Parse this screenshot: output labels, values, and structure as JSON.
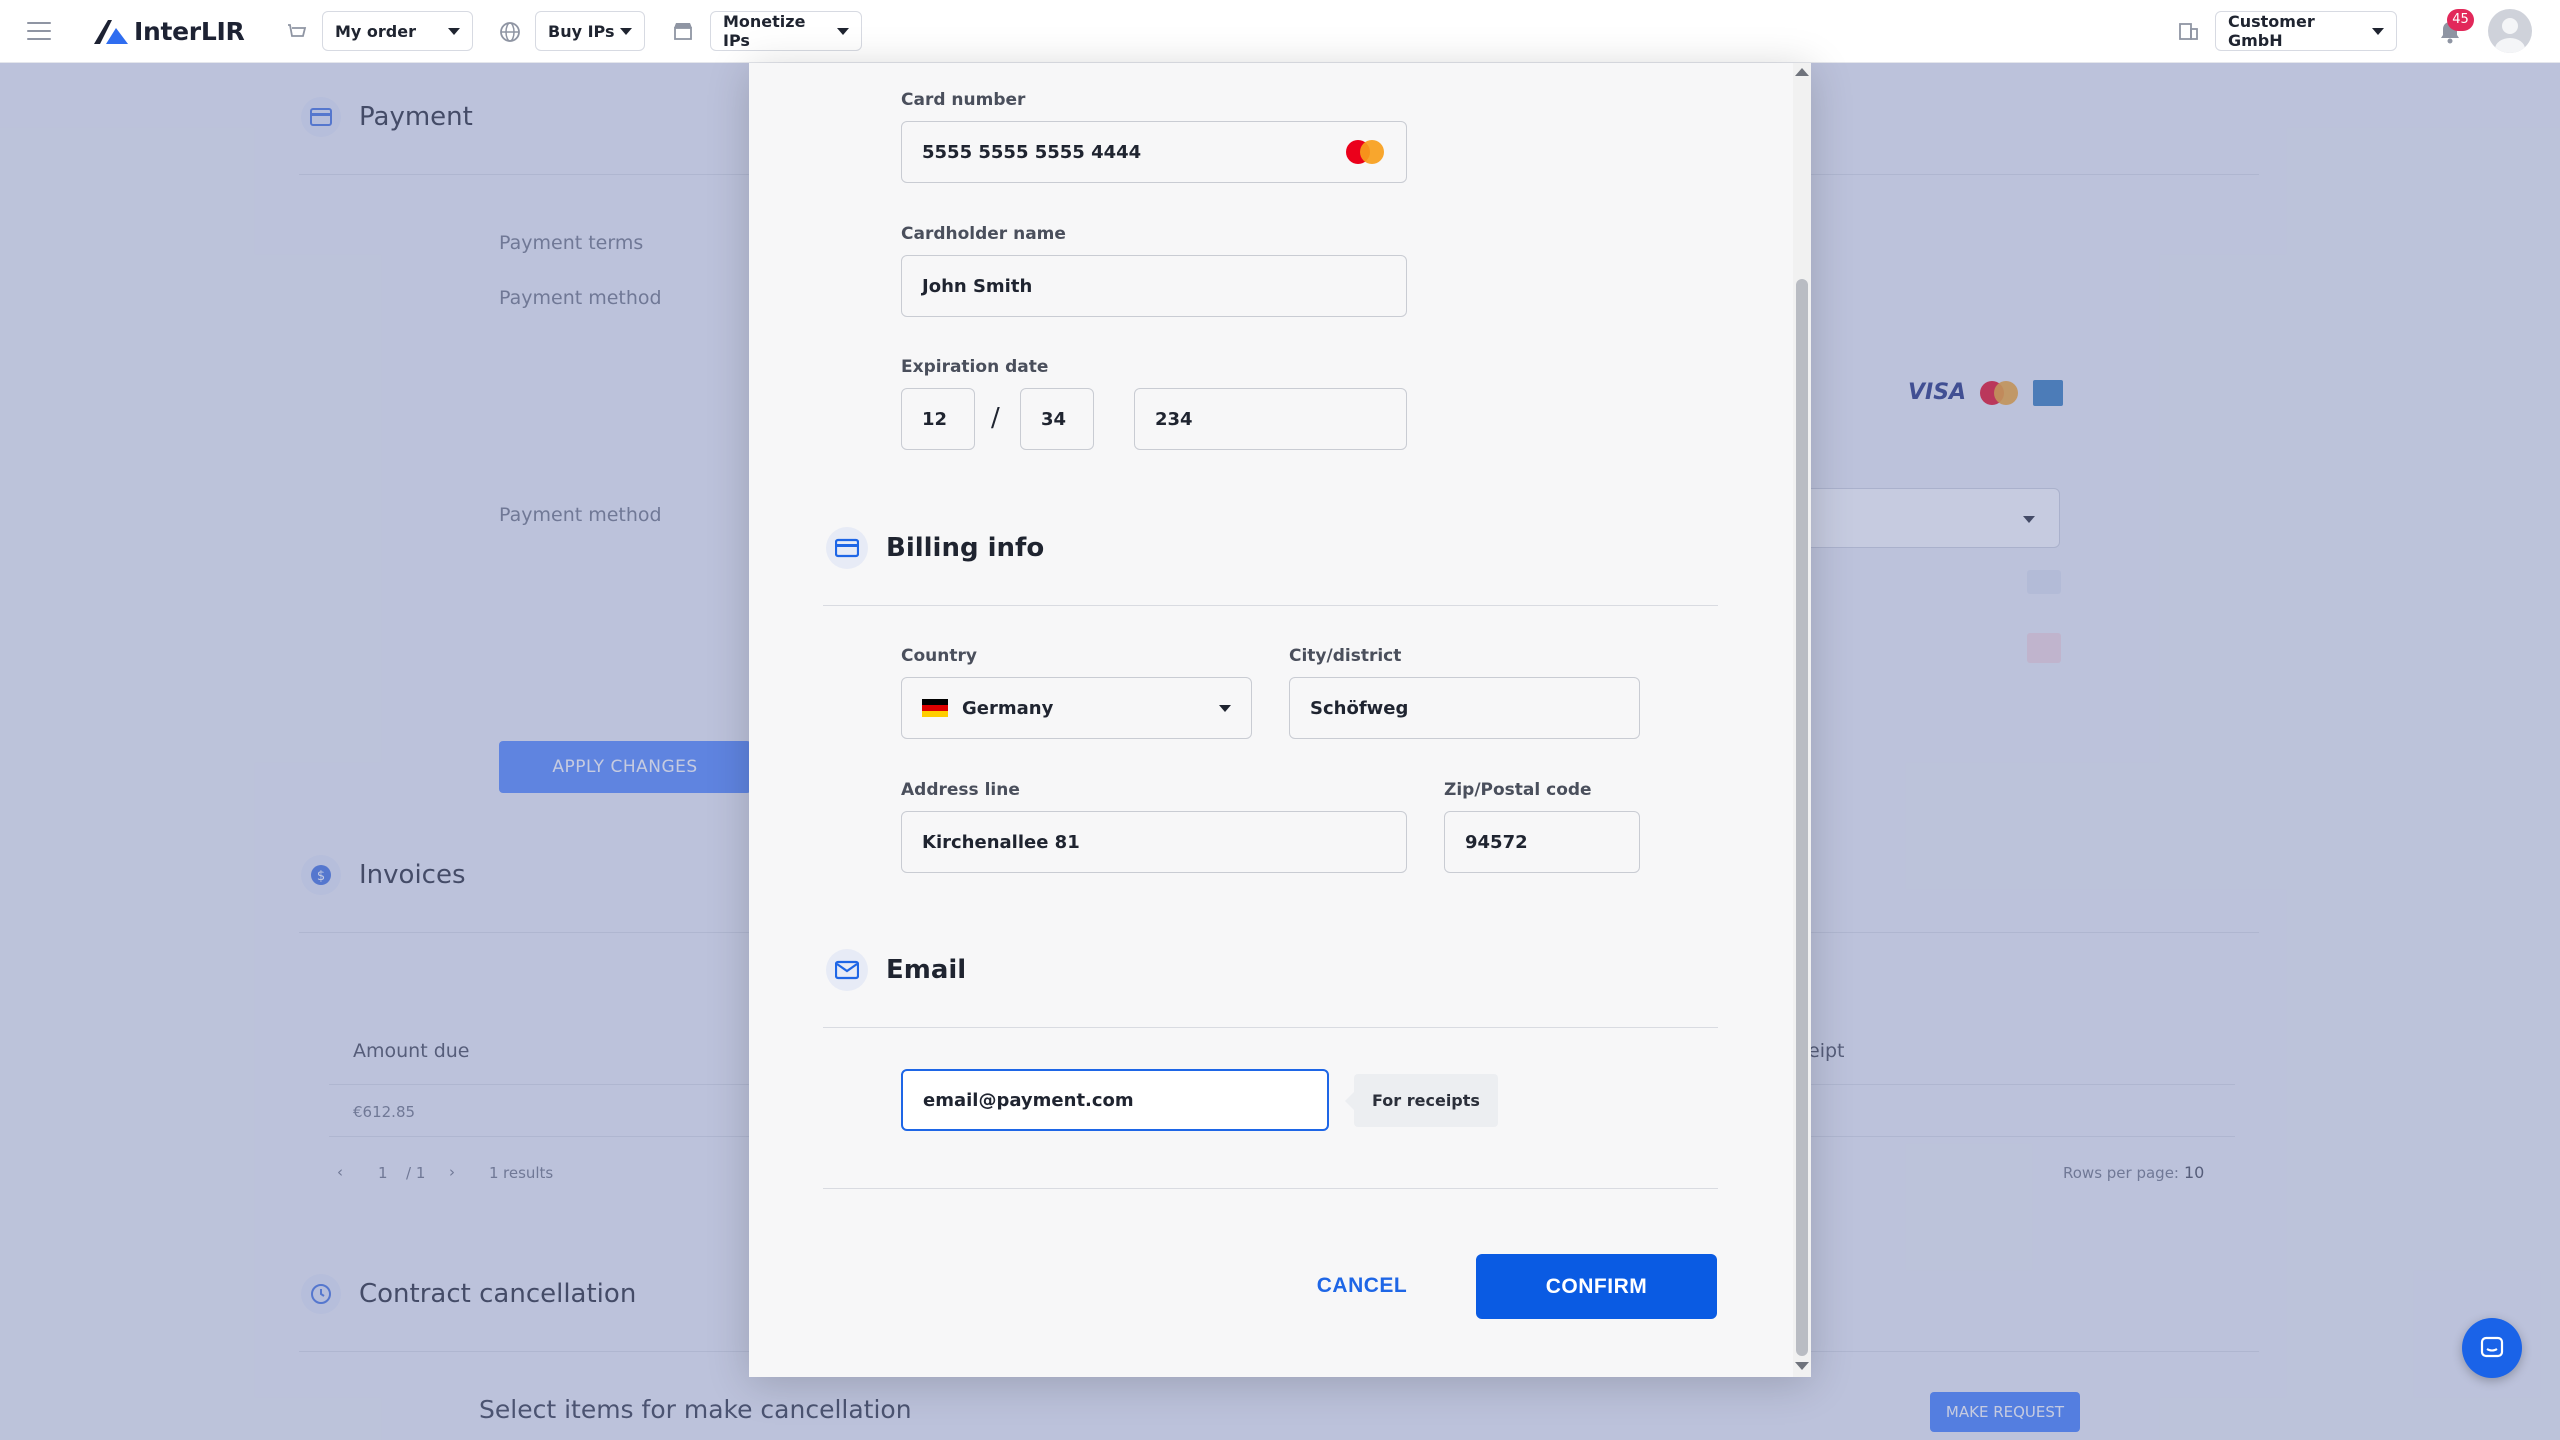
{
  "topbar": {
    "brand": "InterLIR",
    "my_order": "My order",
    "buy_ips": "Buy IPs",
    "monetize_ips": "Monetize IPs",
    "company": "Customer GmbH",
    "notification_count": "45"
  },
  "background": {
    "payment_title": "Payment",
    "payment_terms_label": "Payment terms",
    "payment_method_label": "Payment method",
    "payment_method_label_2": "Payment method",
    "card_brand_visa": "VISA",
    "apply_changes": "APPLY CHANGES",
    "invoices_title": "Invoices",
    "table_header_amount": "Amount due",
    "table_header_receipt": "eipt",
    "table_amount_value": "€612.85",
    "pagination_page": "1",
    "pagination_of": "/ 1",
    "results_count": "1",
    "results_label": "results",
    "rows_per_page_label": "Rows per page:",
    "rows_per_page_value": "10",
    "cancellation_title": "Contract cancellation",
    "cancellation_subtitle": "Select items for make cancellation",
    "make_request": "MAKE REQUEST"
  },
  "modal": {
    "card_number_label": "Card number",
    "card_number": "5555 5555 5555 4444",
    "cardholder_label": "Cardholder name",
    "cardholder": "John Smith",
    "expiration_label": "Expiration date",
    "exp_month": "12",
    "exp_separator": "/",
    "exp_year": "34",
    "cvc": "234",
    "billing_title": "Billing info",
    "country_label": "Country",
    "country": "Germany",
    "city_label": "City/district",
    "city": "Schöfweg",
    "address_label": "Address line",
    "address": "Kirchenallee 81",
    "zip_label": "Zip/Postal code",
    "zip": "94572",
    "email_title": "Email",
    "email": "email@payment.com",
    "email_hint": "For receipts",
    "cancel": "CANCEL",
    "confirm": "CONFIRM"
  },
  "colors": {
    "primary": "#0a5be3",
    "badge": "#e2285a",
    "overlay": "rgba(120,132,180,0.42)"
  }
}
